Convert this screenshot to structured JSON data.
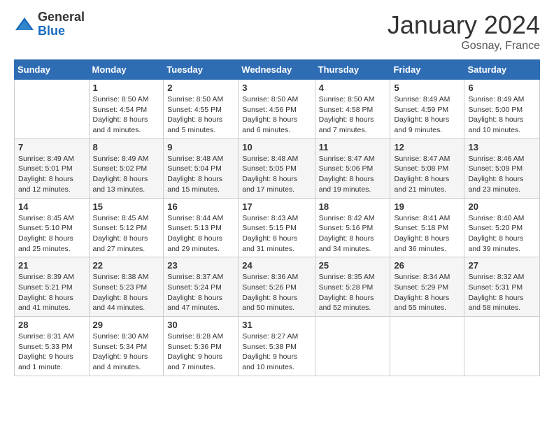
{
  "header": {
    "logo_general": "General",
    "logo_blue": "Blue",
    "month_title": "January 2024",
    "location": "Gosnay, France"
  },
  "days_of_week": [
    "Sunday",
    "Monday",
    "Tuesday",
    "Wednesday",
    "Thursday",
    "Friday",
    "Saturday"
  ],
  "weeks": [
    [
      {
        "day": "",
        "info": ""
      },
      {
        "day": "1",
        "info": "Sunrise: 8:50 AM\nSunset: 4:54 PM\nDaylight: 8 hours\nand 4 minutes."
      },
      {
        "day": "2",
        "info": "Sunrise: 8:50 AM\nSunset: 4:55 PM\nDaylight: 8 hours\nand 5 minutes."
      },
      {
        "day": "3",
        "info": "Sunrise: 8:50 AM\nSunset: 4:56 PM\nDaylight: 8 hours\nand 6 minutes."
      },
      {
        "day": "4",
        "info": "Sunrise: 8:50 AM\nSunset: 4:58 PM\nDaylight: 8 hours\nand 7 minutes."
      },
      {
        "day": "5",
        "info": "Sunrise: 8:49 AM\nSunset: 4:59 PM\nDaylight: 8 hours\nand 9 minutes."
      },
      {
        "day": "6",
        "info": "Sunrise: 8:49 AM\nSunset: 5:00 PM\nDaylight: 8 hours\nand 10 minutes."
      }
    ],
    [
      {
        "day": "7",
        "info": "Sunrise: 8:49 AM\nSunset: 5:01 PM\nDaylight: 8 hours\nand 12 minutes."
      },
      {
        "day": "8",
        "info": "Sunrise: 8:49 AM\nSunset: 5:02 PM\nDaylight: 8 hours\nand 13 minutes."
      },
      {
        "day": "9",
        "info": "Sunrise: 8:48 AM\nSunset: 5:04 PM\nDaylight: 8 hours\nand 15 minutes."
      },
      {
        "day": "10",
        "info": "Sunrise: 8:48 AM\nSunset: 5:05 PM\nDaylight: 8 hours\nand 17 minutes."
      },
      {
        "day": "11",
        "info": "Sunrise: 8:47 AM\nSunset: 5:06 PM\nDaylight: 8 hours\nand 19 minutes."
      },
      {
        "day": "12",
        "info": "Sunrise: 8:47 AM\nSunset: 5:08 PM\nDaylight: 8 hours\nand 21 minutes."
      },
      {
        "day": "13",
        "info": "Sunrise: 8:46 AM\nSunset: 5:09 PM\nDaylight: 8 hours\nand 23 minutes."
      }
    ],
    [
      {
        "day": "14",
        "info": "Sunrise: 8:45 AM\nSunset: 5:10 PM\nDaylight: 8 hours\nand 25 minutes."
      },
      {
        "day": "15",
        "info": "Sunrise: 8:45 AM\nSunset: 5:12 PM\nDaylight: 8 hours\nand 27 minutes."
      },
      {
        "day": "16",
        "info": "Sunrise: 8:44 AM\nSunset: 5:13 PM\nDaylight: 8 hours\nand 29 minutes."
      },
      {
        "day": "17",
        "info": "Sunrise: 8:43 AM\nSunset: 5:15 PM\nDaylight: 8 hours\nand 31 minutes."
      },
      {
        "day": "18",
        "info": "Sunrise: 8:42 AM\nSunset: 5:16 PM\nDaylight: 8 hours\nand 34 minutes."
      },
      {
        "day": "19",
        "info": "Sunrise: 8:41 AM\nSunset: 5:18 PM\nDaylight: 8 hours\nand 36 minutes."
      },
      {
        "day": "20",
        "info": "Sunrise: 8:40 AM\nSunset: 5:20 PM\nDaylight: 8 hours\nand 39 minutes."
      }
    ],
    [
      {
        "day": "21",
        "info": "Sunrise: 8:39 AM\nSunset: 5:21 PM\nDaylight: 8 hours\nand 41 minutes."
      },
      {
        "day": "22",
        "info": "Sunrise: 8:38 AM\nSunset: 5:23 PM\nDaylight: 8 hours\nand 44 minutes."
      },
      {
        "day": "23",
        "info": "Sunrise: 8:37 AM\nSunset: 5:24 PM\nDaylight: 8 hours\nand 47 minutes."
      },
      {
        "day": "24",
        "info": "Sunrise: 8:36 AM\nSunset: 5:26 PM\nDaylight: 8 hours\nand 50 minutes."
      },
      {
        "day": "25",
        "info": "Sunrise: 8:35 AM\nSunset: 5:28 PM\nDaylight: 8 hours\nand 52 minutes."
      },
      {
        "day": "26",
        "info": "Sunrise: 8:34 AM\nSunset: 5:29 PM\nDaylight: 8 hours\nand 55 minutes."
      },
      {
        "day": "27",
        "info": "Sunrise: 8:32 AM\nSunset: 5:31 PM\nDaylight: 8 hours\nand 58 minutes."
      }
    ],
    [
      {
        "day": "28",
        "info": "Sunrise: 8:31 AM\nSunset: 5:33 PM\nDaylight: 9 hours\nand 1 minute."
      },
      {
        "day": "29",
        "info": "Sunrise: 8:30 AM\nSunset: 5:34 PM\nDaylight: 9 hours\nand 4 minutes."
      },
      {
        "day": "30",
        "info": "Sunrise: 8:28 AM\nSunset: 5:36 PM\nDaylight: 9 hours\nand 7 minutes."
      },
      {
        "day": "31",
        "info": "Sunrise: 8:27 AM\nSunset: 5:38 PM\nDaylight: 9 hours\nand 10 minutes."
      },
      {
        "day": "",
        "info": ""
      },
      {
        "day": "",
        "info": ""
      },
      {
        "day": "",
        "info": ""
      }
    ]
  ]
}
